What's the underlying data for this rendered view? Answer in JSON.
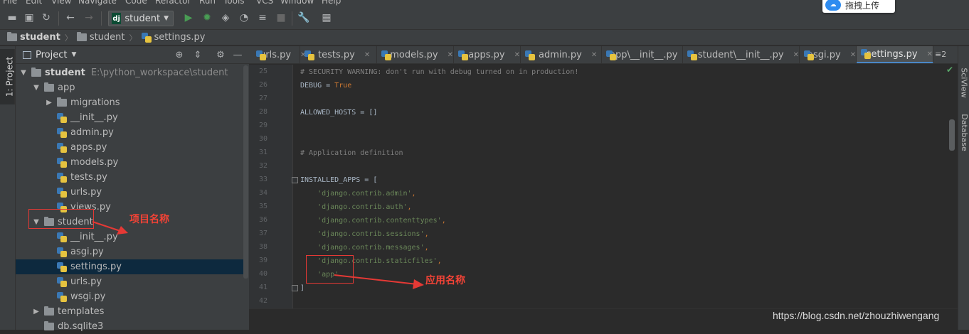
{
  "menu": [
    "File",
    "Edit",
    "View",
    "Navigate",
    "Code",
    "Refactor",
    "Run",
    "Tools",
    "VCS",
    "Window",
    "Help"
  ],
  "toolbar": {
    "run_config_badge": "dj",
    "run_config_label": "student",
    "icons": [
      "open-folder-icon",
      "save-icon",
      "sync-icon",
      "back-icon",
      "forward-icon",
      "run-icon",
      "debug-icon",
      "coverage-icon",
      "profile-icon",
      "concurrency-icon",
      "stop-icon",
      "settings-wrench-icon",
      "sdk-icon"
    ]
  },
  "baidu_upload": {
    "label": "拖拽上传"
  },
  "breadcrumb": [
    "student",
    "student",
    "settings.py"
  ],
  "project_panel": {
    "title": "Project",
    "tool_tab": "1: Project",
    "tree": [
      {
        "label": "student",
        "path": "E:\\python_workspace\\student",
        "type": "folder",
        "expanded": true,
        "depth": 0,
        "bold": true
      },
      {
        "label": "app",
        "type": "folder",
        "expanded": true,
        "depth": 1
      },
      {
        "label": "migrations",
        "type": "folder",
        "expanded": false,
        "depth": 2
      },
      {
        "label": "__init__.py",
        "type": "py",
        "depth": 2
      },
      {
        "label": "admin.py",
        "type": "py",
        "depth": 2
      },
      {
        "label": "apps.py",
        "type": "py",
        "depth": 2
      },
      {
        "label": "models.py",
        "type": "py",
        "depth": 2
      },
      {
        "label": "tests.py",
        "type": "py",
        "depth": 2
      },
      {
        "label": "urls.py",
        "type": "py",
        "depth": 2
      },
      {
        "label": "views.py",
        "type": "py",
        "depth": 2
      },
      {
        "label": "student",
        "type": "folder",
        "expanded": true,
        "depth": 1
      },
      {
        "label": "__init__.py",
        "type": "py",
        "depth": 2
      },
      {
        "label": "asgi.py",
        "type": "py",
        "depth": 2
      },
      {
        "label": "settings.py",
        "type": "py",
        "depth": 2,
        "selected": true
      },
      {
        "label": "urls.py",
        "type": "py",
        "depth": 2
      },
      {
        "label": "wsgi.py",
        "type": "py",
        "depth": 2
      },
      {
        "label": "templates",
        "type": "folder",
        "expanded": false,
        "depth": 1
      },
      {
        "label": "db.sqlite3",
        "type": "file",
        "depth": 1
      }
    ]
  },
  "editor_tabs": [
    {
      "label": "urls.py",
      "active": false
    },
    {
      "label": "tests.py",
      "active": false
    },
    {
      "label": "models.py",
      "active": false
    },
    {
      "label": "apps.py",
      "active": false
    },
    {
      "label": "admin.py",
      "active": false
    },
    {
      "label": "app\\__init__.py",
      "active": false
    },
    {
      "label": "student\\__init__.py",
      "active": false
    },
    {
      "label": "asgi.py",
      "active": false
    },
    {
      "label": "settings.py",
      "active": true
    }
  ],
  "tab_overflow": "≡2",
  "code_lines": [
    {
      "n": "25",
      "parts": [
        {
          "t": "# SECURITY WARNING: don't run with debug turned on in production!",
          "c": "comment"
        }
      ]
    },
    {
      "n": "26",
      "parts": [
        {
          "t": "DEBUG = ",
          "c": "plain"
        },
        {
          "t": "True",
          "c": "kw"
        }
      ]
    },
    {
      "n": "27",
      "parts": []
    },
    {
      "n": "28",
      "parts": [
        {
          "t": "ALLOWED_HOSTS = []",
          "c": "plain"
        }
      ]
    },
    {
      "n": "29",
      "parts": []
    },
    {
      "n": "30",
      "parts": []
    },
    {
      "n": "31",
      "parts": [
        {
          "t": "# Application definition",
          "c": "comment"
        }
      ]
    },
    {
      "n": "32",
      "parts": []
    },
    {
      "n": "33",
      "parts": [
        {
          "t": "INSTALLED_APPS = [",
          "c": "plain"
        }
      ]
    },
    {
      "n": "34",
      "parts": [
        {
          "t": "    'django.contrib.admin'",
          "c": "str"
        },
        {
          "t": ",",
          "c": "kw"
        }
      ]
    },
    {
      "n": "35",
      "parts": [
        {
          "t": "    'django.contrib.auth'",
          "c": "str"
        },
        {
          "t": ",",
          "c": "kw"
        }
      ]
    },
    {
      "n": "36",
      "parts": [
        {
          "t": "    'django.contrib.contenttypes'",
          "c": "str"
        },
        {
          "t": ",",
          "c": "kw"
        }
      ]
    },
    {
      "n": "37",
      "parts": [
        {
          "t": "    'django.contrib.sessions'",
          "c": "str"
        },
        {
          "t": ",",
          "c": "kw"
        }
      ]
    },
    {
      "n": "38",
      "parts": [
        {
          "t": "    'django.contrib.messages'",
          "c": "str"
        },
        {
          "t": ",",
          "c": "kw"
        }
      ]
    },
    {
      "n": "39",
      "parts": [
        {
          "t": "    'django.contrib.staticfiles'",
          "c": "str"
        },
        {
          "t": ",",
          "c": "kw"
        }
      ]
    },
    {
      "n": "40",
      "parts": [
        {
          "t": "    'app'",
          "c": "str"
        }
      ]
    },
    {
      "n": "41",
      "parts": [
        {
          "t": "]",
          "c": "plain"
        }
      ]
    },
    {
      "n": "42",
      "parts": []
    }
  ],
  "right_tools": [
    "SciView",
    "Database"
  ],
  "annotations": {
    "project_name": "项目名称",
    "app_name": "应用名称"
  },
  "watermark": "https://blog.csdn.net/zhouzhiwengang",
  "colors": {
    "annotation_red": "#e53935",
    "selection": "#0d293e",
    "active_tab_underline": "#4a88c7"
  }
}
